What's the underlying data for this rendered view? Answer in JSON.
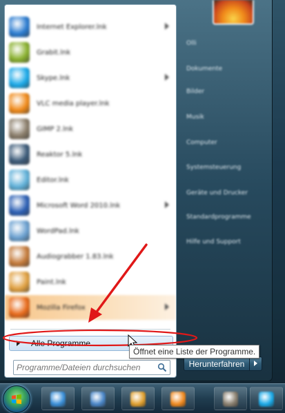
{
  "program_list": [
    {
      "label": "Internet Explorer.lnk",
      "has_submenu": true,
      "icon": "internet-explorer-icon",
      "color": "#2a7bd0"
    },
    {
      "label": "Grabit.lnk",
      "has_submenu": false,
      "icon": "grabit-icon",
      "color": "#8ab12f"
    },
    {
      "label": "Skype.lnk",
      "has_submenu": true,
      "icon": "skype-icon",
      "color": "#1aa9e8"
    },
    {
      "label": "VLC media player.lnk",
      "has_submenu": false,
      "icon": "vlc-icon",
      "color": "#f08a1a"
    },
    {
      "label": "GIMP 2.lnk",
      "has_submenu": false,
      "icon": "gimp-icon",
      "color": "#8a7d6a"
    },
    {
      "label": "Reaktor 5.lnk",
      "has_submenu": false,
      "icon": "reaktor-icon",
      "color": "#3b5a78"
    },
    {
      "label": "Editor.lnk",
      "has_submenu": false,
      "icon": "notepad-icon",
      "color": "#5fb0d8"
    },
    {
      "label": "Microsoft Word 2010.lnk",
      "has_submenu": true,
      "icon": "word-icon",
      "color": "#2b5fb4"
    },
    {
      "label": "WordPad.lnk",
      "has_submenu": false,
      "icon": "wordpad-icon",
      "color": "#6aa0d0"
    },
    {
      "label": "Audiograbber 1.83.lnk",
      "has_submenu": false,
      "icon": "audiograbber-icon",
      "color": "#c47a3a"
    },
    {
      "label": "Paint.lnk",
      "has_submenu": false,
      "icon": "paint-icon",
      "color": "#e0a040"
    },
    {
      "label": "Mozilla Firefox",
      "has_submenu": true,
      "icon": "firefox-icon",
      "color": "#e86a1a",
      "highlighted": true
    }
  ],
  "all_programs_label": "Alle Programme",
  "search": {
    "placeholder": "Programme/Dateien durchsuchen"
  },
  "right_panel": [
    "Olli",
    "Dokumente",
    "Bilder",
    "Musik",
    "Computer",
    "Systemsteuerung",
    "Geräte und Drucker",
    "Standardprogramme",
    "Hilfe und Support"
  ],
  "shutdown_label": "Herunterfahren",
  "tooltip": "Öffnet eine Liste der Programme.",
  "annotation_color": "#e01818",
  "taskbar_apps": [
    {
      "icon": "internet-explorer-taskbar-icon",
      "color": "#3a8fd8"
    },
    {
      "icon": "outlook-taskbar-icon",
      "color": "#4a86c8"
    },
    {
      "icon": "tools-taskbar-icon",
      "color": "#e0a030"
    },
    {
      "icon": "media-player-taskbar-icon",
      "color": "#f08a20"
    },
    {
      "icon": "gimp-taskbar-icon",
      "color": "#8a8070"
    },
    {
      "icon": "skype-taskbar-icon",
      "color": "#1aa9e8"
    }
  ]
}
